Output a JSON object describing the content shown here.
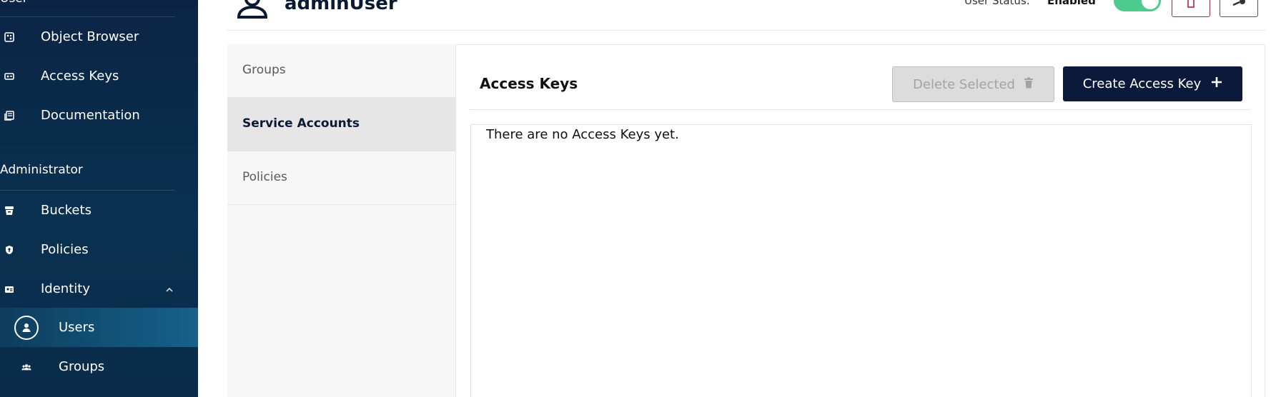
{
  "sidebar": {
    "top_partial": "User",
    "items": [
      {
        "label": "Object Browser",
        "icon": "object-browser-icon"
      },
      {
        "label": "Access Keys",
        "icon": "access-keys-icon"
      },
      {
        "label": "Documentation",
        "icon": "documentation-icon"
      }
    ],
    "section_admin": "Administrator",
    "admin_items": [
      {
        "label": "Buckets",
        "icon": "buckets-icon"
      },
      {
        "label": "Policies",
        "icon": "policies-icon"
      },
      {
        "label": "Identity",
        "icon": "identity-icon"
      }
    ],
    "identity_sub": [
      {
        "label": "Users",
        "icon": "user-icon",
        "active": true
      },
      {
        "label": "Groups",
        "icon": "groups-icon"
      }
    ]
  },
  "header": {
    "title": "adminUser",
    "status_label": "User Status:",
    "status_value": "Enabled",
    "toggle_on": true
  },
  "tabs": [
    {
      "label": "Groups"
    },
    {
      "label": "Service Accounts",
      "active": true
    },
    {
      "label": "Policies"
    }
  ],
  "content": {
    "title": "Access Keys",
    "delete_label": "Delete Selected",
    "create_label": "Create Access Key",
    "empty_message": "There are no Access Keys yet."
  },
  "colors": {
    "sidebar_bg": "#0b2444",
    "active_item": "#16618a",
    "primary_button": "#0b1a3b",
    "toggle_on": "#4ccb8d",
    "danger": "#c51b3f"
  }
}
